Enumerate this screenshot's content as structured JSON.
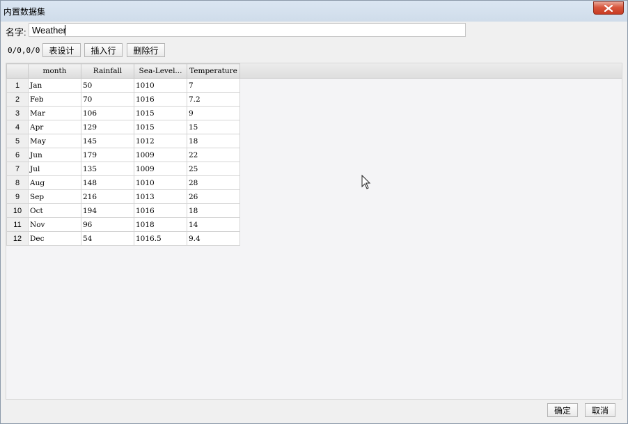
{
  "window": {
    "title": "内置数据集"
  },
  "name_field": {
    "label": "名字:",
    "value": "Weather"
  },
  "toolbar": {
    "counter": "0/0,0/0",
    "table_design": "表设计",
    "insert_row": "插入行",
    "delete_row": "删除行"
  },
  "grid": {
    "columns": [
      "month",
      "Rainfall",
      "Sea-Level...",
      "Temperature"
    ],
    "rows": [
      {
        "num": "1",
        "month": "Jan",
        "rainfall": "50",
        "sealevel": "1010",
        "temperature": "7"
      },
      {
        "num": "2",
        "month": "Feb",
        "rainfall": "70",
        "sealevel": "1016",
        "temperature": "7.2"
      },
      {
        "num": "3",
        "month": "Mar",
        "rainfall": "106",
        "sealevel": "1015",
        "temperature": "9"
      },
      {
        "num": "4",
        "month": "Apr",
        "rainfall": "129",
        "sealevel": "1015",
        "temperature": "15"
      },
      {
        "num": "5",
        "month": "May",
        "rainfall": "145",
        "sealevel": "1012",
        "temperature": "18"
      },
      {
        "num": "6",
        "month": "Jun",
        "rainfall": "179",
        "sealevel": "1009",
        "temperature": "22"
      },
      {
        "num": "7",
        "month": "Jul",
        "rainfall": "135",
        "sealevel": "1009",
        "temperature": "25"
      },
      {
        "num": "8",
        "month": "Aug",
        "rainfall": "148",
        "sealevel": "1010",
        "temperature": "28"
      },
      {
        "num": "9",
        "month": "Sep",
        "rainfall": "216",
        "sealevel": "1013",
        "temperature": "26"
      },
      {
        "num": "10",
        "month": "Oct",
        "rainfall": "194",
        "sealevel": "1016",
        "temperature": "18"
      },
      {
        "num": "11",
        "month": "Nov",
        "rainfall": "96",
        "sealevel": "1018",
        "temperature": "14"
      },
      {
        "num": "12",
        "month": "Dec",
        "rainfall": "54",
        "sealevel": "1016.5",
        "temperature": "9.4"
      }
    ]
  },
  "footer": {
    "ok": "确定",
    "cancel": "取消"
  },
  "icons": {
    "close": "close-icon",
    "cursor": "mouse-pointer-icon"
  }
}
